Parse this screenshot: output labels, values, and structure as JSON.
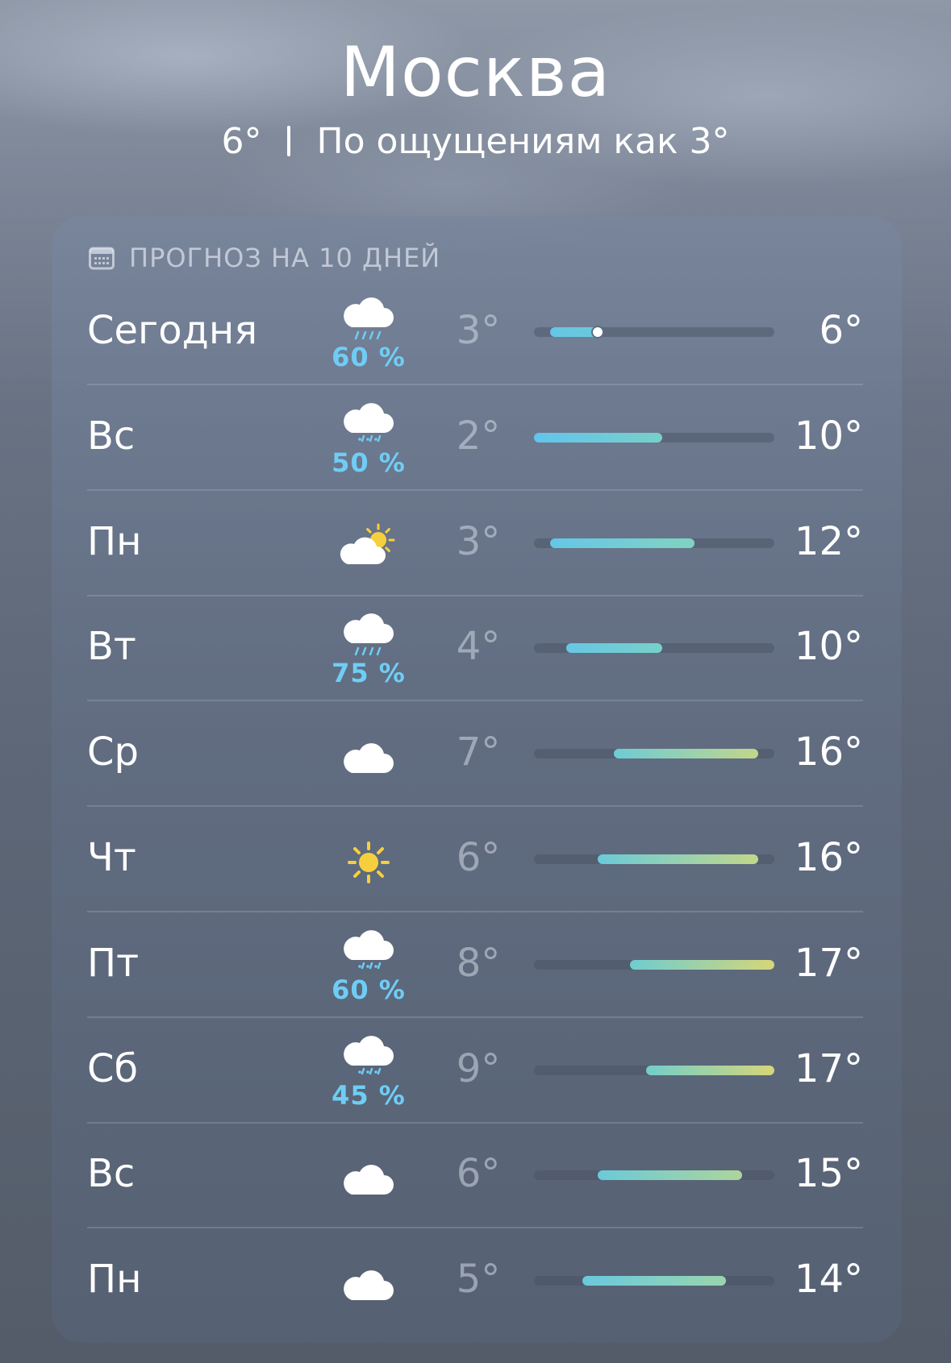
{
  "header": {
    "city": "Москва",
    "current_temp": "6°",
    "feels_like": "По ощущениям как 3°"
  },
  "forecast": {
    "title": "ПРОГНОЗ НА 10 ДНЕЙ",
    "title_icon": "calendar-icon",
    "scale_min": 2,
    "scale_max": 17,
    "days": [
      {
        "day": "Сегодня",
        "icon": "cloud-rain-icon",
        "precip": "60 %",
        "low": "3°",
        "high": "6°",
        "low_val": 3,
        "high_val": 6,
        "current_val": 6
      },
      {
        "day": "Вс",
        "icon": "cloud-drizzle-icon",
        "precip": "50 %",
        "low": "2°",
        "high": "10°",
        "low_val": 2,
        "high_val": 10
      },
      {
        "day": "Пн",
        "icon": "cloud-sun-icon",
        "precip": "",
        "low": "3°",
        "high": "12°",
        "low_val": 3,
        "high_val": 12
      },
      {
        "day": "Вт",
        "icon": "cloud-rain-icon",
        "precip": "75 %",
        "low": "4°",
        "high": "10°",
        "low_val": 4,
        "high_val": 10
      },
      {
        "day": "Ср",
        "icon": "cloud-icon",
        "precip": "",
        "low": "7°",
        "high": "16°",
        "low_val": 7,
        "high_val": 16
      },
      {
        "day": "Чт",
        "icon": "sun-icon",
        "precip": "",
        "low": "6°",
        "high": "16°",
        "low_val": 6,
        "high_val": 16
      },
      {
        "day": "Пт",
        "icon": "cloud-drizzle-icon",
        "precip": "60 %",
        "low": "8°",
        "high": "17°",
        "low_val": 8,
        "high_val": 17
      },
      {
        "day": "Сб",
        "icon": "cloud-drizzle-icon",
        "precip": "45 %",
        "low": "9°",
        "high": "17°",
        "low_val": 9,
        "high_val": 17
      },
      {
        "day": "Вс",
        "icon": "cloud-icon",
        "precip": "",
        "low": "6°",
        "high": "15°",
        "low_val": 6,
        "high_val": 15
      },
      {
        "day": "Пн",
        "icon": "cloud-icon",
        "precip": "",
        "low": "5°",
        "high": "14°",
        "low_val": 5,
        "high_val": 14
      }
    ]
  }
}
